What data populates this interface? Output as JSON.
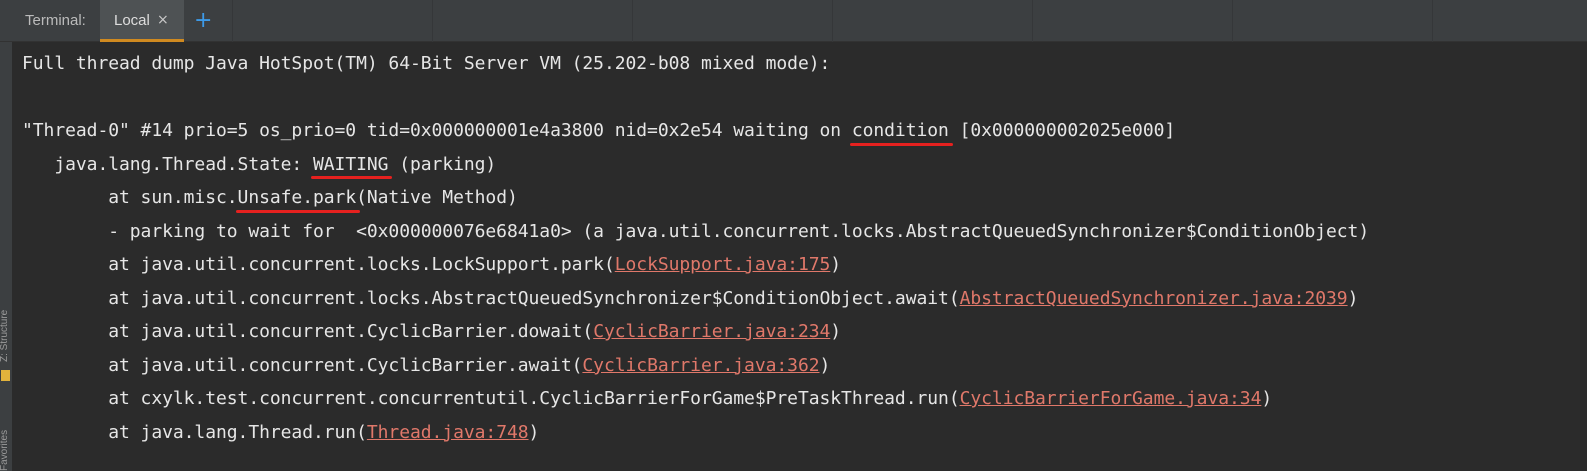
{
  "header": {
    "panel_title": "Terminal:",
    "tab_label": "Local",
    "close_glyph": "×",
    "add_glyph": "+"
  },
  "sidebar": {
    "structure_label": "Z: Structure",
    "favorites_label": "Favorites"
  },
  "terminal": {
    "line1": "Full thread dump Java HotSpot(TM) 64-Bit Server VM (25.202-b08 mixed mode):",
    "line3_pre": "\"Thread-0\" #14 prio=5 os_prio=0 tid=0x000000001e4a3800 nid=0x2e54 waiting on ",
    "line3_hl": "condition",
    "line3_post": " [0x000000002025e000]",
    "line4_pre": "   java.lang.Thread.State: ",
    "line4_hl": "WAITING",
    "line4_post": " (parking)",
    "line5_pre": "        at sun.misc.",
    "line5_hl": "Unsafe.park",
    "line5_post": "(Native Method)",
    "line6": "        - parking to wait for  <0x000000076e6841a0> (a java.util.concurrent.locks.AbstractQueuedSynchronizer$ConditionObject)",
    "frames": [
      {
        "pre": "        at java.util.concurrent.locks.LockSupport.park(",
        "link": "LockSupport.java:175",
        "post": ")"
      },
      {
        "pre": "        at java.util.concurrent.locks.AbstractQueuedSynchronizer$ConditionObject.await(",
        "link": "AbstractQueuedSynchronizer.java:2039",
        "post": ")"
      },
      {
        "pre": "        at java.util.concurrent.CyclicBarrier.dowait(",
        "link": "CyclicBarrier.java:234",
        "post": ")"
      },
      {
        "pre": "        at java.util.concurrent.CyclicBarrier.await(",
        "link": "CyclicBarrier.java:362",
        "post": ")"
      },
      {
        "pre": "        at cxylk.test.concurrent.concurrentutil.CyclicBarrierForGame$PreTaskThread.run(",
        "link": "CyclicBarrierForGame.java:34",
        "post": ")"
      },
      {
        "pre": "        at java.lang.Thread.run(",
        "link": "Thread.java:748",
        "post": ")"
      }
    ]
  },
  "colors": {
    "background": "#2b2b2b",
    "text": "#e6e6e6",
    "link": "#e0786a",
    "annotation": "#e6211f",
    "tab_accent": "#d08a20",
    "add_icon": "#3d9ae8"
  }
}
